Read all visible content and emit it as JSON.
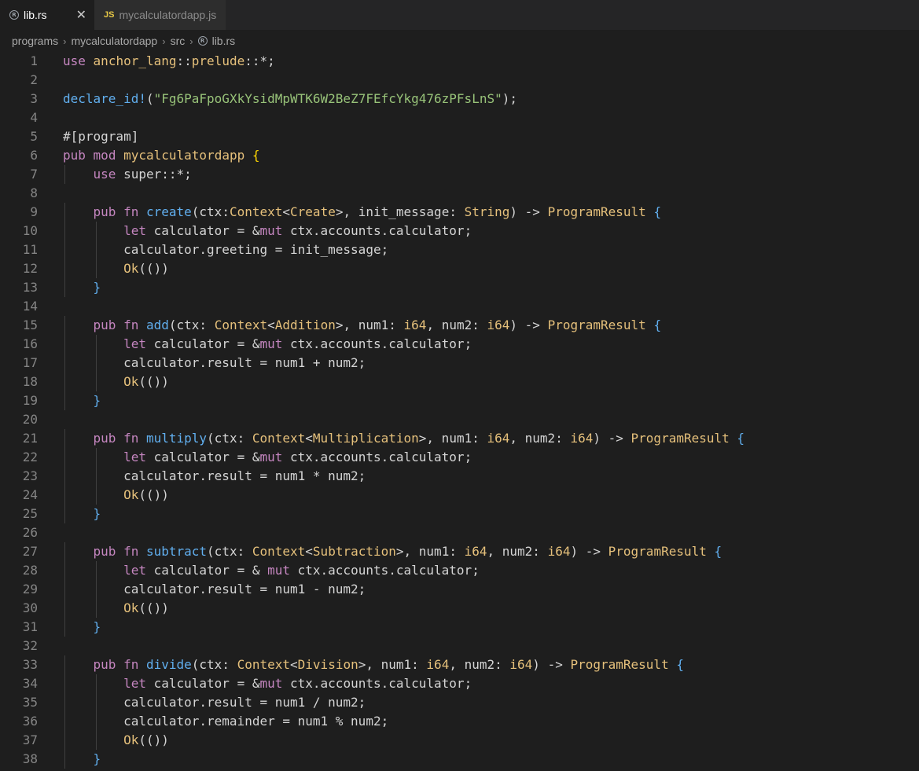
{
  "tabs": [
    {
      "label": "lib.rs",
      "active": true,
      "icon": "rust-icon"
    },
    {
      "label": "mycalculatordapp.js",
      "active": false,
      "icon": "js-icon",
      "icon_text": "JS"
    }
  ],
  "breadcrumb": [
    "programs",
    "mycalculatordapp",
    "src",
    "lib.rs"
  ],
  "lines": [
    [
      [
        "kw",
        "use"
      ],
      [
        "pl",
        " "
      ],
      [
        "ty",
        "anchor_lang"
      ],
      [
        "pl",
        "::"
      ],
      [
        "ty",
        "prelude"
      ],
      [
        "pl",
        "::*;"
      ]
    ],
    [],
    [
      [
        "fn",
        "declare_id!"
      ],
      [
        "pl",
        "("
      ],
      [
        "st",
        "\"Fg6PaFpoGXkYsidMpWTK6W2BeZ7FEfcYkg476zPFsLnS\""
      ],
      [
        "pl",
        ");"
      ]
    ],
    [],
    [
      [
        "pl",
        "#["
      ],
      [
        "pl",
        "program"
      ],
      [
        "pl",
        "]"
      ]
    ],
    [
      [
        "kw",
        "pub"
      ],
      [
        "pl",
        " "
      ],
      [
        "kw",
        "mod"
      ],
      [
        "pl",
        " "
      ],
      [
        "ty",
        "mycalculatordapp"
      ],
      [
        "pl",
        " "
      ],
      [
        "br",
        "{"
      ]
    ],
    [
      [
        "pl",
        "    "
      ],
      [
        "kw",
        "use"
      ],
      [
        "pl",
        " super::*;"
      ]
    ],
    [],
    [
      [
        "pl",
        "    "
      ],
      [
        "kw",
        "pub"
      ],
      [
        "pl",
        " "
      ],
      [
        "kw",
        "fn"
      ],
      [
        "pl",
        " "
      ],
      [
        "fn",
        "create"
      ],
      [
        "pl",
        "(ctx:"
      ],
      [
        "ty",
        "Context"
      ],
      [
        "pl",
        "<"
      ],
      [
        "ty",
        "Create"
      ],
      [
        "pl",
        ">, init_message: "
      ],
      [
        "ty",
        "String"
      ],
      [
        "pl",
        ") -> "
      ],
      [
        "ty",
        "ProgramResult"
      ],
      [
        "pl",
        " "
      ],
      [
        "fn",
        "{"
      ]
    ],
    [
      [
        "pl",
        "        "
      ],
      [
        "kw",
        "let"
      ],
      [
        "pl",
        " calculator = &"
      ],
      [
        "kw",
        "mut"
      ],
      [
        "pl",
        " ctx.accounts.calculator;"
      ]
    ],
    [
      [
        "pl",
        "        calculator.greeting = init_message;"
      ]
    ],
    [
      [
        "pl",
        "        "
      ],
      [
        "ty",
        "Ok"
      ],
      [
        "pl",
        "(())"
      ]
    ],
    [
      [
        "pl",
        "    "
      ],
      [
        "fn",
        "}"
      ]
    ],
    [],
    [
      [
        "pl",
        "    "
      ],
      [
        "kw",
        "pub"
      ],
      [
        "pl",
        " "
      ],
      [
        "kw",
        "fn"
      ],
      [
        "pl",
        " "
      ],
      [
        "fn",
        "add"
      ],
      [
        "pl",
        "(ctx: "
      ],
      [
        "ty",
        "Context"
      ],
      [
        "pl",
        "<"
      ],
      [
        "ty",
        "Addition"
      ],
      [
        "pl",
        ">, num1: "
      ],
      [
        "ty",
        "i64"
      ],
      [
        "pl",
        ", num2: "
      ],
      [
        "ty",
        "i64"
      ],
      [
        "pl",
        ") -> "
      ],
      [
        "ty",
        "ProgramResult"
      ],
      [
        "pl",
        " "
      ],
      [
        "fn",
        "{"
      ]
    ],
    [
      [
        "pl",
        "        "
      ],
      [
        "kw",
        "let"
      ],
      [
        "pl",
        " calculator = &"
      ],
      [
        "kw",
        "mut"
      ],
      [
        "pl",
        " ctx.accounts.calculator;"
      ]
    ],
    [
      [
        "pl",
        "        calculator.result = num1 + num2;"
      ]
    ],
    [
      [
        "pl",
        "        "
      ],
      [
        "ty",
        "Ok"
      ],
      [
        "pl",
        "(())"
      ]
    ],
    [
      [
        "pl",
        "    "
      ],
      [
        "fn",
        "}"
      ]
    ],
    [],
    [
      [
        "pl",
        "    "
      ],
      [
        "kw",
        "pub"
      ],
      [
        "pl",
        " "
      ],
      [
        "kw",
        "fn"
      ],
      [
        "pl",
        " "
      ],
      [
        "fn",
        "multiply"
      ],
      [
        "pl",
        "(ctx: "
      ],
      [
        "ty",
        "Context"
      ],
      [
        "pl",
        "<"
      ],
      [
        "ty",
        "Multiplication"
      ],
      [
        "pl",
        ">, num1: "
      ],
      [
        "ty",
        "i64"
      ],
      [
        "pl",
        ", num2: "
      ],
      [
        "ty",
        "i64"
      ],
      [
        "pl",
        ") -> "
      ],
      [
        "ty",
        "ProgramResult"
      ],
      [
        "pl",
        " "
      ],
      [
        "fn",
        "{"
      ]
    ],
    [
      [
        "pl",
        "        "
      ],
      [
        "kw",
        "let"
      ],
      [
        "pl",
        " calculator = &"
      ],
      [
        "kw",
        "mut"
      ],
      [
        "pl",
        " ctx.accounts.calculator;"
      ]
    ],
    [
      [
        "pl",
        "        calculator.result = num1 * num2;"
      ]
    ],
    [
      [
        "pl",
        "        "
      ],
      [
        "ty",
        "Ok"
      ],
      [
        "pl",
        "(())"
      ]
    ],
    [
      [
        "pl",
        "    "
      ],
      [
        "fn",
        "}"
      ]
    ],
    [],
    [
      [
        "pl",
        "    "
      ],
      [
        "kw",
        "pub"
      ],
      [
        "pl",
        " "
      ],
      [
        "kw",
        "fn"
      ],
      [
        "pl",
        " "
      ],
      [
        "fn",
        "subtract"
      ],
      [
        "pl",
        "(ctx: "
      ],
      [
        "ty",
        "Context"
      ],
      [
        "pl",
        "<"
      ],
      [
        "ty",
        "Subtraction"
      ],
      [
        "pl",
        ">, num1: "
      ],
      [
        "ty",
        "i64"
      ],
      [
        "pl",
        ", num2: "
      ],
      [
        "ty",
        "i64"
      ],
      [
        "pl",
        ") -> "
      ],
      [
        "ty",
        "ProgramResult"
      ],
      [
        "pl",
        " "
      ],
      [
        "fn",
        "{"
      ]
    ],
    [
      [
        "pl",
        "        "
      ],
      [
        "kw",
        "let"
      ],
      [
        "pl",
        " calculator = & "
      ],
      [
        "kw",
        "mut"
      ],
      [
        "pl",
        " ctx.accounts.calculator;"
      ]
    ],
    [
      [
        "pl",
        "        calculator.result = num1 - num2;"
      ]
    ],
    [
      [
        "pl",
        "        "
      ],
      [
        "ty",
        "Ok"
      ],
      [
        "pl",
        "(())"
      ]
    ],
    [
      [
        "pl",
        "    "
      ],
      [
        "fn",
        "}"
      ]
    ],
    [],
    [
      [
        "pl",
        "    "
      ],
      [
        "kw",
        "pub"
      ],
      [
        "pl",
        " "
      ],
      [
        "kw",
        "fn"
      ],
      [
        "pl",
        " "
      ],
      [
        "fn",
        "divide"
      ],
      [
        "pl",
        "(ctx: "
      ],
      [
        "ty",
        "Context"
      ],
      [
        "pl",
        "<"
      ],
      [
        "ty",
        "Division"
      ],
      [
        "pl",
        ">, num1: "
      ],
      [
        "ty",
        "i64"
      ],
      [
        "pl",
        ", num2: "
      ],
      [
        "ty",
        "i64"
      ],
      [
        "pl",
        ") -> "
      ],
      [
        "ty",
        "ProgramResult"
      ],
      [
        "pl",
        " "
      ],
      [
        "fn",
        "{"
      ]
    ],
    [
      [
        "pl",
        "        "
      ],
      [
        "kw",
        "let"
      ],
      [
        "pl",
        " calculator = &"
      ],
      [
        "kw",
        "mut"
      ],
      [
        "pl",
        " ctx.accounts.calculator;"
      ]
    ],
    [
      [
        "pl",
        "        calculator.result = num1 / num2;"
      ]
    ],
    [
      [
        "pl",
        "        calculator.remainder = num1 % num2;"
      ]
    ],
    [
      [
        "pl",
        "        "
      ],
      [
        "ty",
        "Ok"
      ],
      [
        "pl",
        "(())"
      ]
    ],
    [
      [
        "pl",
        "    "
      ],
      [
        "fn",
        "}"
      ]
    ]
  ],
  "colors": {
    "keyword": "#c586c0",
    "type": "#e5c07b",
    "function": "#61afef",
    "string": "#98c379",
    "plain": "#d4d4d4",
    "line_number": "#858585",
    "background": "#1e1e1e"
  }
}
